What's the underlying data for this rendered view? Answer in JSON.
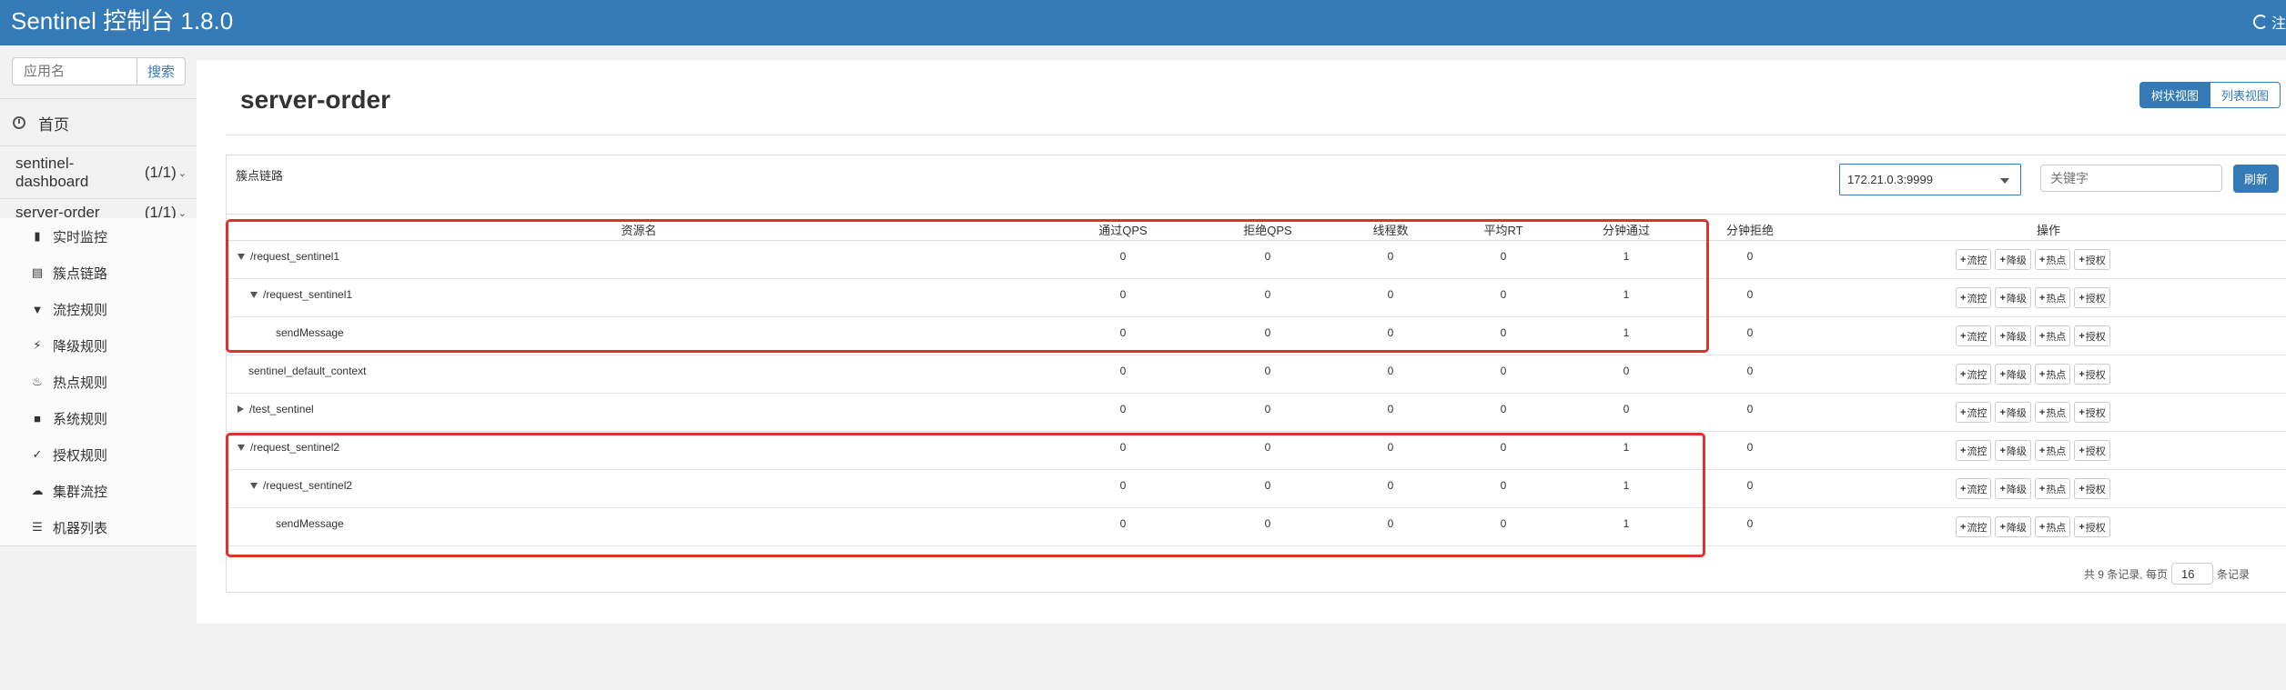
{
  "navbar": {
    "brand": "Sentinel 控制台 1.8.0",
    "logout_label": "注"
  },
  "sidebar": {
    "search_placeholder": "应用名",
    "search_button": "搜索",
    "home_label": "首页",
    "apps": [
      {
        "name": "sentinel-dashboard",
        "count": "(1/1)"
      },
      {
        "name": "server-order",
        "count": "(1/1)"
      }
    ],
    "menu": [
      {
        "label": "实时监控",
        "icon": "bar-chart-icon"
      },
      {
        "label": "簇点链路",
        "icon": "list-icon"
      },
      {
        "label": "流控规则",
        "icon": "filter-icon"
      },
      {
        "label": "降级规则",
        "icon": "flash-icon"
      },
      {
        "label": "热点规则",
        "icon": "fire-icon"
      },
      {
        "label": "系统规则",
        "icon": "lock-icon"
      },
      {
        "label": "授权规则",
        "icon": "check-circle-icon"
      },
      {
        "label": "集群流控",
        "icon": "cloud-icon"
      },
      {
        "label": "机器列表",
        "icon": "th-list-icon"
      }
    ]
  },
  "main": {
    "title": "server-order",
    "view_tree": "树状视图",
    "view_list": "列表视图",
    "panel_title": "簇点链路",
    "machine": "172.21.0.3:9999",
    "keyword_placeholder": "关键字",
    "refresh": "刷新",
    "columns": [
      "资源名",
      "通过QPS",
      "拒绝QPS",
      "线程数",
      "平均RT",
      "分钟通过",
      "分钟拒绝",
      "操作"
    ],
    "op_labels": [
      "流控",
      "降级",
      "热点",
      "授权"
    ],
    "rows": [
      {
        "resource": "/request_sentinel1",
        "indent": 0,
        "toggle": "down",
        "pass_qps": "0",
        "block_qps": "0",
        "threads": "0",
        "avg_rt": "0",
        "minute_pass": "1",
        "minute_block": "0"
      },
      {
        "resource": "/request_sentinel1",
        "indent": 1,
        "toggle": "down",
        "pass_qps": "0",
        "block_qps": "0",
        "threads": "0",
        "avg_rt": "0",
        "minute_pass": "1",
        "minute_block": "0"
      },
      {
        "resource": "sendMessage",
        "indent": 2,
        "toggle": "none",
        "pass_qps": "0",
        "block_qps": "0",
        "threads": "0",
        "avg_rt": "0",
        "minute_pass": "1",
        "minute_block": "0"
      },
      {
        "resource": "sentinel_default_context",
        "indent": 0,
        "toggle": "none",
        "pass_qps": "0",
        "block_qps": "0",
        "threads": "0",
        "avg_rt": "0",
        "minute_pass": "0",
        "minute_block": "0"
      },
      {
        "resource": "/test_sentinel",
        "indent": 0,
        "toggle": "right",
        "pass_qps": "0",
        "block_qps": "0",
        "threads": "0",
        "avg_rt": "0",
        "minute_pass": "0",
        "minute_block": "0"
      },
      {
        "resource": "/request_sentinel2",
        "indent": 0,
        "toggle": "down",
        "pass_qps": "0",
        "block_qps": "0",
        "threads": "0",
        "avg_rt": "0",
        "minute_pass": "1",
        "minute_block": "0"
      },
      {
        "resource": "/request_sentinel2",
        "indent": 1,
        "toggle": "down",
        "pass_qps": "0",
        "block_qps": "0",
        "threads": "0",
        "avg_rt": "0",
        "minute_pass": "1",
        "minute_block": "0"
      },
      {
        "resource": "sendMessage",
        "indent": 2,
        "toggle": "none",
        "pass_qps": "0",
        "block_qps": "0",
        "threads": "0",
        "avg_rt": "0",
        "minute_pass": "1",
        "minute_block": "0"
      }
    ],
    "pager": {
      "prefix": "共 9 条记录, 每页",
      "page_size": "16",
      "suffix": "条记录"
    }
  },
  "colors": {
    "brand": "#337ab7",
    "highlight": "#e03131"
  }
}
